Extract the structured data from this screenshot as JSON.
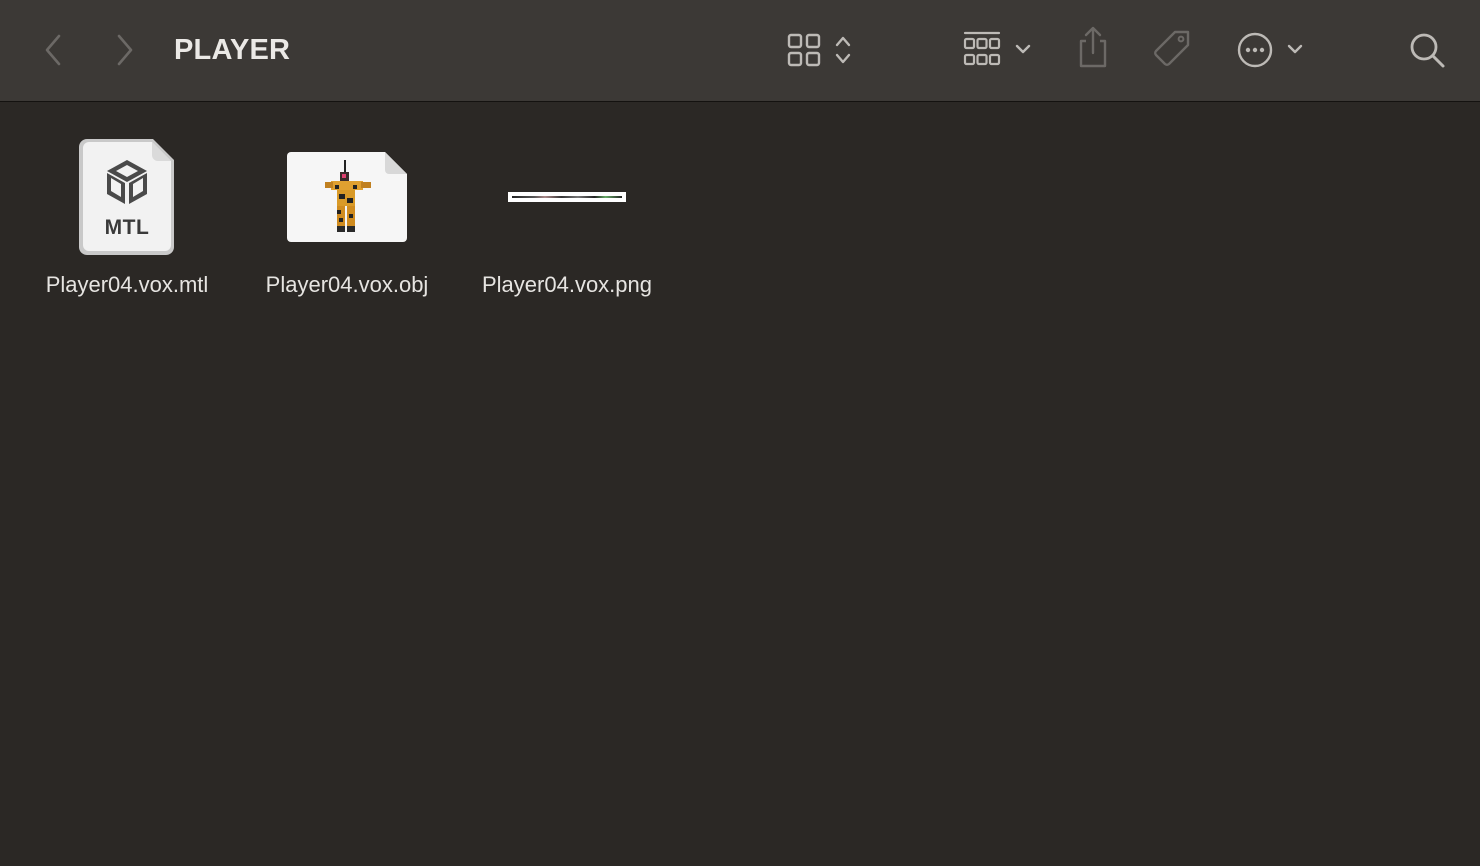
{
  "window": {
    "title": "PLAYER"
  },
  "toolbar": {
    "back_icon": "chevron-left-icon",
    "forward_icon": "chevron-right-icon",
    "view_icon": "icon-grid-icon",
    "group_icon": "group-grid-icon",
    "share_icon": "share-icon",
    "tag_icon": "tag-icon",
    "more_icon": "ellipsis-circle-icon",
    "search_icon": "search-icon"
  },
  "files": [
    {
      "name": "Player04.vox.mtl",
      "kind": "mtl-document",
      "badge": "MTL"
    },
    {
      "name": "Player04.vox.obj",
      "kind": "obj-preview"
    },
    {
      "name": "Player04.vox.png",
      "kind": "png-strip"
    }
  ],
  "colors": {
    "toolbar_bg": "#3c3936",
    "content_bg": "#2b2825",
    "text": "#e6e4e1",
    "icon": "#bdbab6",
    "icon_disabled": "#6c6966"
  }
}
